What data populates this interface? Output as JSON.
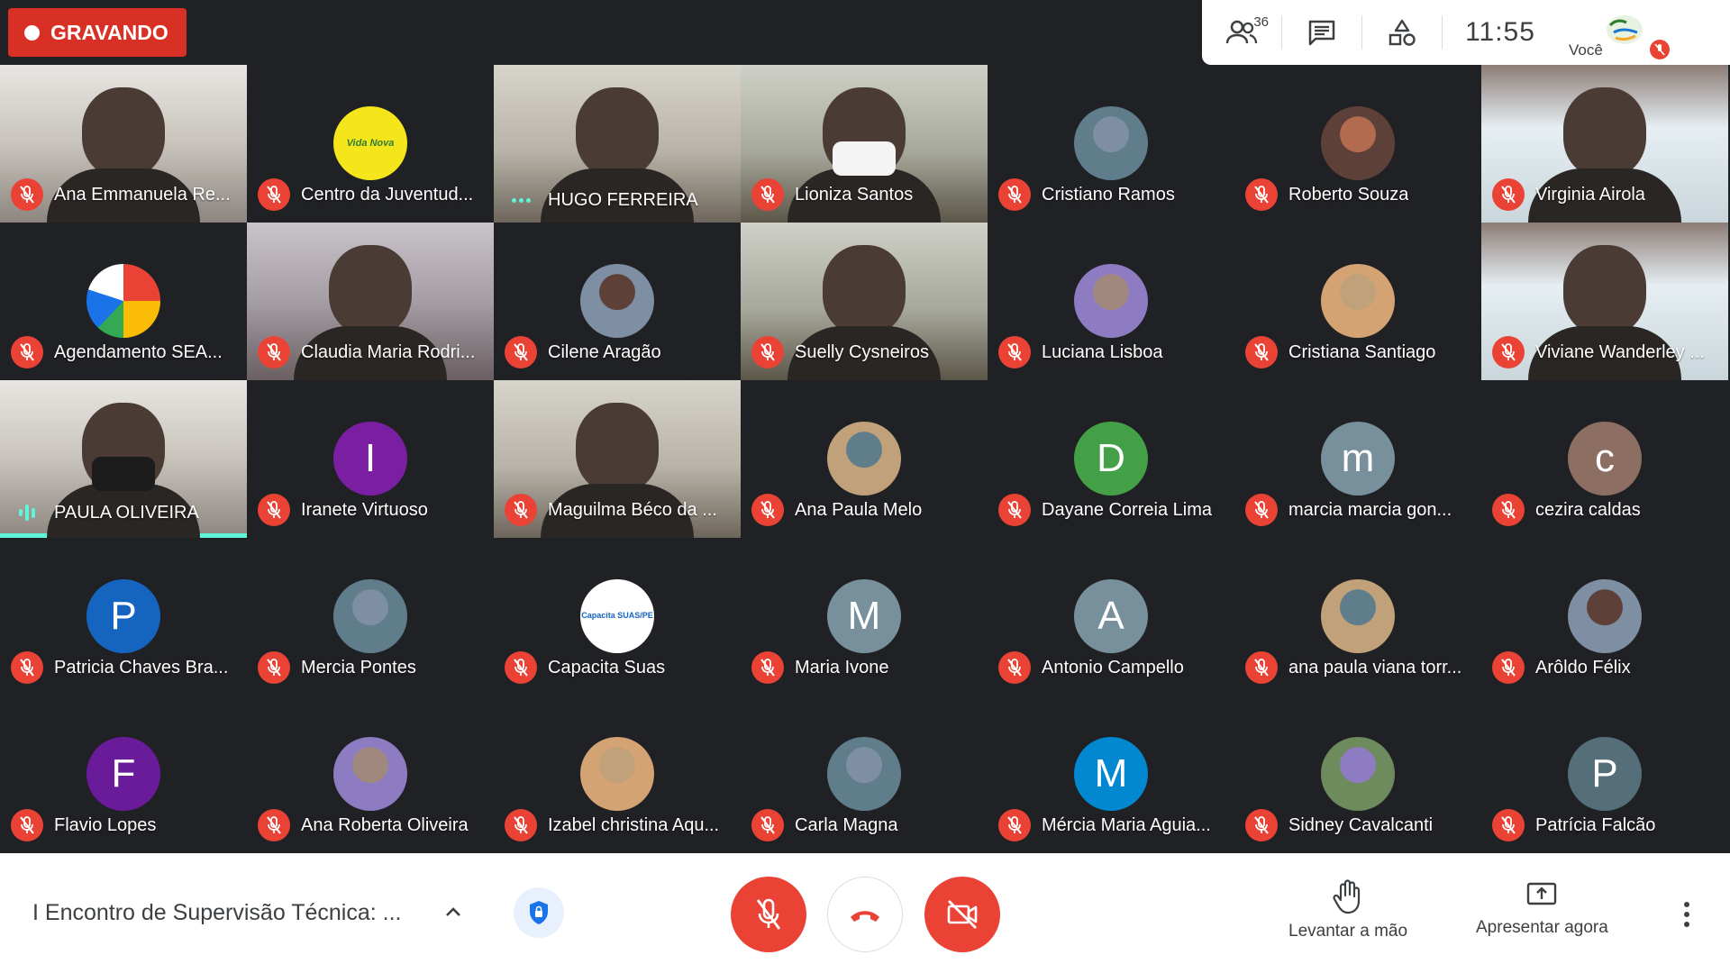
{
  "recording": {
    "label": "GRAVANDO"
  },
  "topbar": {
    "participant_count": "36",
    "clock": "11:55",
    "self_label": "Você"
  },
  "participants": [
    {
      "name": "Ana Emmanuela Re...",
      "kind": "video"
    },
    {
      "name": "Centro da Juventud...",
      "kind": "logo",
      "logo_text": "Vida Nova"
    },
    {
      "name": "HUGO FERREIRA",
      "kind": "video",
      "audio": "speaking-dots"
    },
    {
      "name": "Lioniza Santos",
      "kind": "video"
    },
    {
      "name": "Cristiano Ramos",
      "kind": "photo"
    },
    {
      "name": "Roberto Souza",
      "kind": "photo"
    },
    {
      "name": "Virginia Airola",
      "kind": "video"
    },
    {
      "name": "Agendamento SEA...",
      "kind": "logo"
    },
    {
      "name": "Claudia Maria Rodri...",
      "kind": "video"
    },
    {
      "name": "Cilene Aragão",
      "kind": "photo"
    },
    {
      "name": "Suelly Cysneiros",
      "kind": "video"
    },
    {
      "name": "Luciana Lisboa",
      "kind": "photo"
    },
    {
      "name": "Cristiana Santiago",
      "kind": "photo"
    },
    {
      "name": "Viviane Wanderley ...",
      "kind": "video"
    },
    {
      "name": "PAULA OLIVEIRA",
      "kind": "video",
      "audio": "speaking-bars"
    },
    {
      "name": "Iranete Virtuoso",
      "kind": "initial",
      "initial": "I",
      "color": "#7b1fa2"
    },
    {
      "name": "Maguilma Béco da ...",
      "kind": "video"
    },
    {
      "name": "Ana Paula Melo",
      "kind": "photo"
    },
    {
      "name": "Dayane Correia Lima",
      "kind": "initial",
      "initial": "D",
      "color": "#43a047"
    },
    {
      "name": "marcia marcia gon...",
      "kind": "initial",
      "initial": "m",
      "color": "#78909c"
    },
    {
      "name": "cezira caldas",
      "kind": "initial",
      "initial": "c",
      "color": "#8d6e63"
    },
    {
      "name": "Patricia Chaves Bra...",
      "kind": "initial",
      "initial": "P",
      "color": "#1565c0"
    },
    {
      "name": "Mercia Pontes",
      "kind": "photo"
    },
    {
      "name": "Capacita Suas",
      "kind": "logo",
      "logo_text": "Capacita SUAS/PE"
    },
    {
      "name": "Maria Ivone",
      "kind": "initial",
      "initial": "M",
      "color": "#78909c"
    },
    {
      "name": "Antonio Campello",
      "kind": "initial",
      "initial": "A",
      "color": "#78909c"
    },
    {
      "name": "ana paula viana torr...",
      "kind": "photo"
    },
    {
      "name": "Arôldo Félix",
      "kind": "photo"
    },
    {
      "name": "Flavio Lopes",
      "kind": "initial",
      "initial": "F",
      "color": "#6a1b9a"
    },
    {
      "name": "Ana Roberta Oliveira",
      "kind": "photo"
    },
    {
      "name": "Izabel christina Aqu...",
      "kind": "photo"
    },
    {
      "name": "Carla Magna",
      "kind": "photo"
    },
    {
      "name": "Mércia Maria Aguia...",
      "kind": "initial",
      "initial": "M",
      "color": "#0288d1"
    },
    {
      "name": "Sidney Cavalcanti",
      "kind": "photo"
    },
    {
      "name": "Patrícia Falcão",
      "kind": "initial",
      "initial": "P",
      "color": "#546e7a"
    }
  ],
  "bottombar": {
    "meeting_title": "I Encontro de Supervisão Técnica: ...",
    "raise_hand_label": "Levantar a mão",
    "present_label": "Apresentar agora"
  },
  "colors": {
    "danger": "#ea4335",
    "speaking": "#5ff5d8",
    "background": "#202124"
  }
}
